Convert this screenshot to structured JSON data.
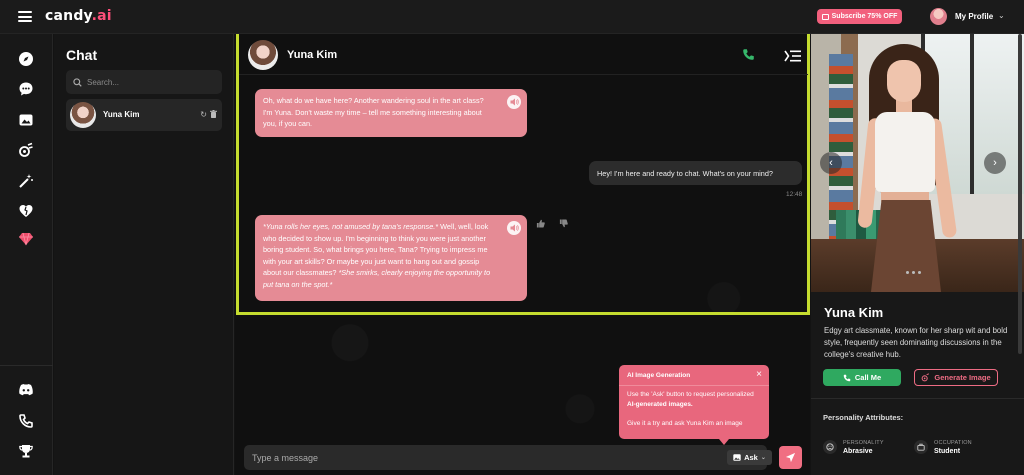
{
  "topbar": {
    "logo_main": "candy",
    "logo_accent": ".ai",
    "subscribe_label": "Subscribe 75% OFF",
    "profile_label": "My Profile"
  },
  "rail": {
    "icons": [
      "compass-icon",
      "chat-icon",
      "gallery-icon",
      "generate-icon",
      "wand-icon",
      "heart-icon",
      "premium-gem-icon",
      "discord-icon",
      "phone-support-icon",
      "trophy-icon"
    ]
  },
  "chatlist": {
    "heading": "Chat",
    "search_placeholder": "Search...",
    "items": [
      {
        "name": "Yuna Kim"
      }
    ]
  },
  "conversation": {
    "character_name": "Yuna Kim",
    "messages": [
      {
        "role": "ai",
        "text": "Oh, what do we have here? Another wandering soul in the art class? I'm Yuna. Don't waste my time – tell me something interesting about you, if you can."
      },
      {
        "role": "user",
        "text": "Hey! I'm here and ready to chat. What's on your mind?",
        "time": "12:48"
      },
      {
        "role": "ai",
        "italic1": "*Yuna rolls her eyes, not amused by tana's response.*",
        "text": " Well, well, look who decided to show up. I'm beginning to think you were just another boring student. So, what brings you here, Tana? Trying to impress me with your art skills? Or maybe you just want to hang out and gossip about our classmates? ",
        "italic2": "*She smirks, clearly enjoying the opportunity to put tana on the spot.*"
      }
    ]
  },
  "tooltip": {
    "title": "AI Image Generation",
    "body_prefix": "Use the 'Ask' button to request personalized ",
    "body_bold": "AI-generated images.",
    "body2": "Give it a try and ask Yuna Kim an image"
  },
  "composer": {
    "placeholder": "Type a message",
    "ask_label": "Ask"
  },
  "profile": {
    "name": "Yuna Kim",
    "description": "Edgy art classmate, known for her sharp wit and bold style, frequently seen dominating discussions in the college's creative hub.",
    "call_label": "Call Me",
    "generate_label": "Generate Image",
    "attributes_title": "Personality Attributes:",
    "attributes": [
      {
        "caption": "PERSONALITY",
        "value": "Abrasive"
      },
      {
        "caption": "OCCUPATION",
        "value": "Student"
      }
    ]
  },
  "colors": {
    "accent": "#ff4f7a",
    "ai_bubble": "#e58b95",
    "highlight_frame": "#c5dc2f",
    "call_green": "#2fa960"
  }
}
